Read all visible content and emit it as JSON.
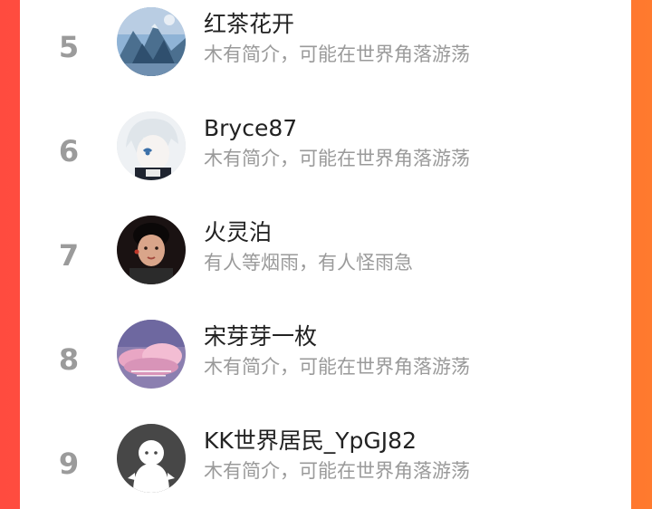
{
  "rankings": [
    {
      "rank": "5",
      "name": "红茶花开",
      "bio": "木有简介，可能在世界角落游荡",
      "avatar": "mountain-painting-avatar"
    },
    {
      "rank": "6",
      "name": "Bryce87",
      "bio": "木有简介，可能在世界角落游荡",
      "avatar": "anime-character-avatar"
    },
    {
      "rank": "7",
      "name": "火灵泊",
      "bio": "有人等烟雨，有人怪雨急",
      "avatar": "portrait-photo-avatar"
    },
    {
      "rank": "8",
      "name": "宋芽芽一枚",
      "bio": "木有简介，可能在世界角落游荡",
      "avatar": "pink-cloud-sky-avatar"
    },
    {
      "rank": "9",
      "name": "KK世界居民_YpGJ82",
      "bio": "木有简介，可能在世界角落游荡",
      "avatar": "default-ghost-avatar"
    }
  ]
}
